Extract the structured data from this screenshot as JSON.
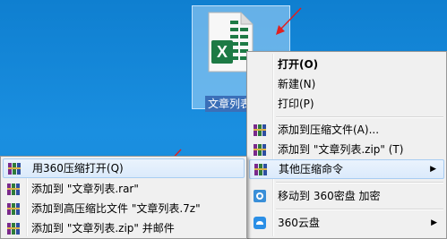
{
  "desktop": {
    "file_icon": {
      "name": "文章列表.zip",
      "label_visible": "文章列表",
      "icon": "excel-file-icon",
      "badge_letter": "X"
    }
  },
  "context_menu": {
    "items": [
      {
        "label": "打开(O)",
        "bold": true
      },
      {
        "label": "新建(N)"
      },
      {
        "label": "打印(P)"
      },
      {
        "label": "添加到压缩文件(A)...",
        "icon": "winrar-icon"
      },
      {
        "label": "添加到 \"文章列表.zip\" (T)",
        "icon": "winrar-icon"
      },
      {
        "label": "其他压缩命令",
        "icon": "winrar-icon",
        "highlighted": true,
        "submenu": true
      },
      {
        "label": "移动到 360密盘 加密",
        "icon": "360-vault-icon"
      },
      {
        "label": "360云盘",
        "icon": "360-cloud-icon",
        "submenu": true
      }
    ]
  },
  "submenu": {
    "items": [
      {
        "label": "用360压缩打开(Q)",
        "icon": "winrar-icon",
        "highlighted": true
      },
      {
        "label": "添加到 \"文章列表.rar\"",
        "icon": "winrar-icon"
      },
      {
        "label": "添加到高压缩比文件 \"文章列表.7z\"",
        "icon": "winrar-icon"
      },
      {
        "label": "添加到 \"文章列表.zip\" 并邮件",
        "icon": "winrar-icon"
      }
    ]
  },
  "submenu_arrow_glyph": "▶",
  "colors": {
    "desktop_bg": "#1487d6",
    "menu_bg": "#f0f0f0",
    "highlight": "#dbeafb",
    "arrow": "#e02020",
    "excel_green": "#1d7a45"
  }
}
